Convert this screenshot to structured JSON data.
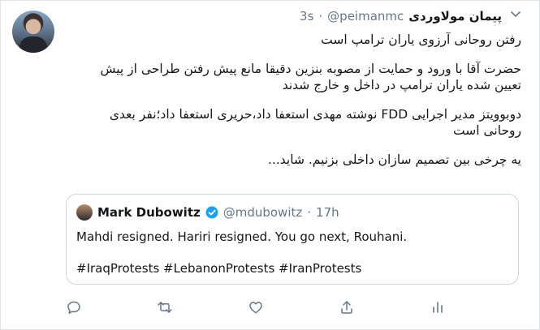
{
  "tweet": {
    "author_name": "پیمان مولاوردی",
    "handle": "@peimanmc",
    "separator": "·",
    "time": "3s",
    "paragraphs": [
      "رفتن روحانی آرزوی یاران ترامپ است",
      "حضرت آقا با ورود و حمایت از مصوبه بنزین دقیقا مانع پیش رفتن طراحی از پیش تعیین شده یاران ترامپ در داخل و خارج شدند",
      "دوبوویتز مدیر اجرایی FDD نوشته مهدی استعفا داد،حریری استعفا داد؛نفر بعدی روحانی است",
      "یه چرخی بین تصمیم سازان داخلی بزنیم. شاید..."
    ]
  },
  "quoted": {
    "author_name": "Mark Dubowitz",
    "handle": "@mdubowitz",
    "separator": "·",
    "time": "17h",
    "text": "Mahdi resigned. Hariri resigned. You go next, Rouhani.",
    "hashtags": "#IraqProtests #LebanonProtests #IranProtests"
  },
  "icons": {
    "reply": "reply-icon",
    "retweet": "retweet-icon",
    "like": "heart-icon",
    "share": "share-icon",
    "analytics": "analytics-icon",
    "menu": "chevron-down-icon",
    "verified": "verified-badge-icon"
  },
  "colors": {
    "text": "#14171a",
    "muted": "#657786",
    "verified": "#1da1f2",
    "border": "#ccd6dd"
  }
}
